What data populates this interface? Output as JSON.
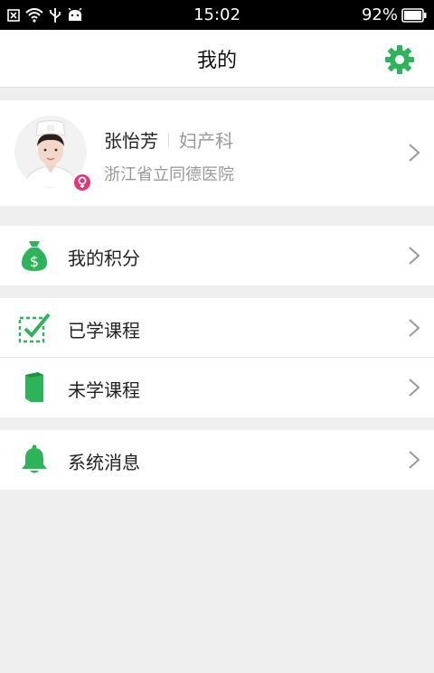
{
  "status_bar": {
    "time": "15:02",
    "battery": "92%",
    "icons": [
      "notification-x-icon",
      "wifi-icon",
      "usb-icon",
      "android-icon",
      "battery-icon"
    ]
  },
  "header": {
    "title": "我的",
    "settings_icon": "gear-icon"
  },
  "profile": {
    "name": "张怡芳",
    "department": "妇产科",
    "hospital": "浙江省立同德医院",
    "gender_icon": "female-icon"
  },
  "menu": {
    "points": {
      "label": "我的积分",
      "icon": "money-bag-icon"
    },
    "learned": {
      "label": "已学课程",
      "icon": "checkbox-icon"
    },
    "unlearned": {
      "label": "未学课程",
      "icon": "book-icon"
    },
    "messages": {
      "label": "系统消息",
      "icon": "bell-icon"
    }
  },
  "colors": {
    "accent": "#2db35a",
    "badge": "#e5337a",
    "background": "#efefef"
  }
}
